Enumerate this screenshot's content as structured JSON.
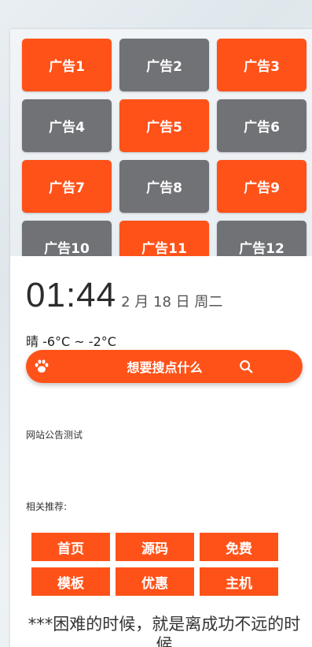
{
  "ads": [
    {
      "label": "广告1",
      "color": "#ff5219"
    },
    {
      "label": "广告2",
      "color": "#717276"
    },
    {
      "label": "广告3",
      "color": "#ff5219"
    },
    {
      "label": "广告4",
      "color": "#717276"
    },
    {
      "label": "广告5",
      "color": "#ff5219"
    },
    {
      "label": "广告6",
      "color": "#717276"
    },
    {
      "label": "广告7",
      "color": "#ff5219"
    },
    {
      "label": "广告8",
      "color": "#717276"
    },
    {
      "label": "广告9",
      "color": "#ff5219"
    },
    {
      "label": "广告10",
      "color": "#717276"
    },
    {
      "label": "广告11",
      "color": "#ff5219"
    },
    {
      "label": "广告12",
      "color": "#717276"
    }
  ],
  "clock": {
    "time": "01:44",
    "date": "2 月 18 日 周二"
  },
  "weather": "晴 -6°C ~ -2°C",
  "search": {
    "placeholder": "想要搜点什么",
    "left_icon": "paw-icon",
    "right_icon": "search-icon",
    "accent": "#ff5219"
  },
  "notice": "网站公告测试",
  "related_label": "相关推荐:",
  "links": [
    "首页",
    "源码",
    "免费",
    "模板",
    "优惠",
    "主机"
  ],
  "quote": "***困难的时候，就是离成功不远的时候"
}
